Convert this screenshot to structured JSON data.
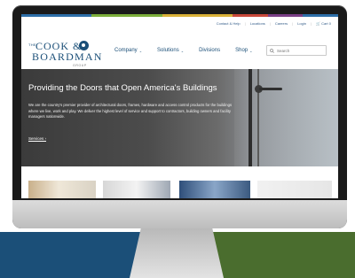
{
  "brand": {
    "the": "THE",
    "line1": "COOK &",
    "line2": "BOARDMAN",
    "group": "GROUP"
  },
  "utility_nav": {
    "items": [
      "Contact & Help",
      "Locations",
      "Careers",
      "Login",
      "Cart 0"
    ]
  },
  "main_nav": {
    "items": [
      {
        "label": "Company",
        "has_menu": true
      },
      {
        "label": "Solutions",
        "has_menu": true
      },
      {
        "label": "Divisions",
        "has_menu": false
      },
      {
        "label": "Shop",
        "has_menu": true
      }
    ]
  },
  "search": {
    "placeholder": "Search"
  },
  "hero": {
    "title": "Providing the Doors that Open America's Buildings",
    "body": "We are the country's premier provider of architectural doors, frames, hardware and access control products for the buildings where we live, work and play. We deliver the highest level of service and support to contractors, building owners and facility managers nationwide.",
    "link": "Services ›"
  },
  "colors": {
    "top_bar": [
      "#2d6ea8",
      "#2d6ea8",
      "#7cae3b",
      "#7cae3b",
      "#d9b138",
      "#d9b138",
      "#c8483a",
      "#7a3f86",
      "#2d6ea8"
    ],
    "brand_blue": "#1b4f78",
    "band_left": "#1b4f78",
    "band_right": "#4a6d2e"
  }
}
